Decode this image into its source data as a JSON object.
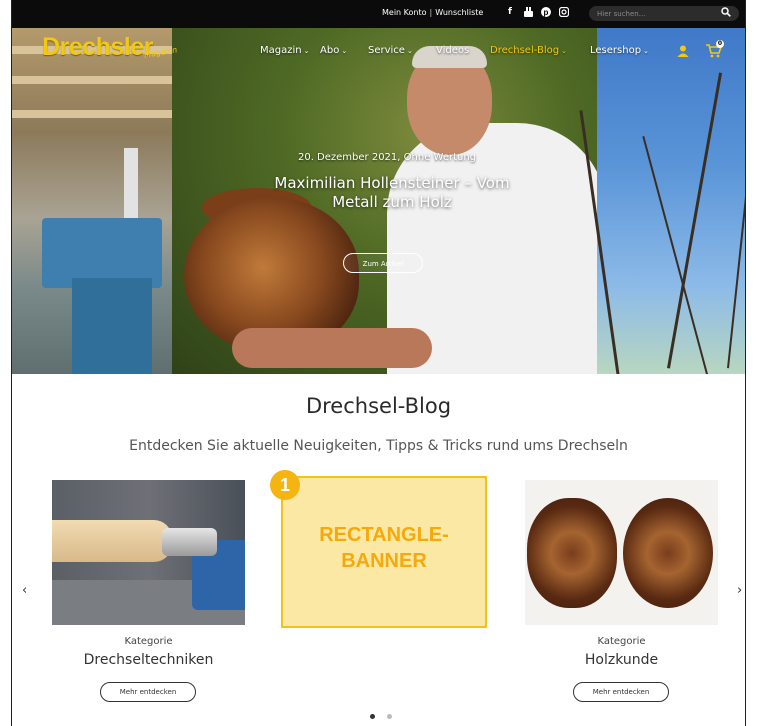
{
  "topbar": {
    "links": [
      "Mein Konto",
      "Wunschliste"
    ],
    "separator": "|",
    "social_icons": [
      "facebook-icon",
      "youtube-icon",
      "pinterest-icon",
      "instagram-icon"
    ],
    "search_placeholder": "Hier suchen..."
  },
  "logo": {
    "text": "Drechsler",
    "subtext": "Magazin"
  },
  "nav": {
    "items": [
      {
        "label": "Magazin",
        "dropdown": true
      },
      {
        "label": "Abo",
        "dropdown": true
      },
      {
        "label": "Service",
        "dropdown": true
      },
      {
        "label": "Videos",
        "dropdown": false
      },
      {
        "label": "Drechsel-Blog",
        "dropdown": true,
        "active": true
      },
      {
        "label": "Lesershop",
        "dropdown": true
      }
    ],
    "caret": "⌄",
    "cart_count": "0",
    "accent": "#f3c90f"
  },
  "hero": {
    "date": "20. Dezember 2021, Ohne Wertung",
    "title": "Maximilian Hollensteiner – Vom Metall zum Holz",
    "button": "Zum Artikel"
  },
  "blog": {
    "title": "Drechsel-Blog",
    "subtitle": "Entdecken Sie aktuelle Neuigkeiten, Tipps & Tricks rund ums Drechseln",
    "cards": [
      {
        "kategorie": "Kategorie",
        "name": "Drechseltechniken",
        "button": "Mehr entdecken"
      },
      {
        "kategorie": "Kategorie",
        "name": "Holzkunde",
        "button": "Mehr entdecken"
      }
    ],
    "banner": {
      "badge": "1",
      "text": "RECTANGLE-\nBANNER"
    },
    "prev_arrow": "‹",
    "next_arrow": "›",
    "pagination": {
      "active_dot": 0,
      "count": 2
    }
  }
}
